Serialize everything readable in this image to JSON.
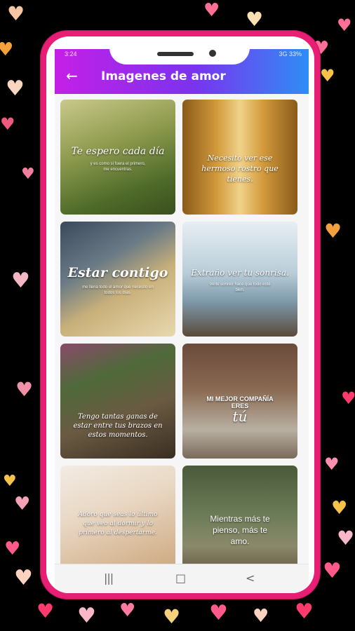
{
  "status": {
    "time": "3:24",
    "right": "3G 33%"
  },
  "appbar": {
    "title": "Imagenes de amor",
    "back_icon": "arrow-left-icon"
  },
  "cards": [
    {
      "caption": "Te espero cada día",
      "sub": "y es como si fuera el primero, me encuentras."
    },
    {
      "caption": "Necesito ver ese hermoso rostro que tienes."
    },
    {
      "caption": "Estar contigo",
      "sub": "me llena todo el amor que necesito en todos los días."
    },
    {
      "caption": "Extraño ver tu sonrisa.",
      "sub": "Verte sonreír hace que todo esté bien."
    },
    {
      "caption": "Tengo tantas ganas de estar entre tus brazos en estos momentos."
    },
    {
      "caption": "MI MEJOR COMPAÑÍA ERES",
      "emph": "tú"
    },
    {
      "caption": "Adoro que seas lo último que veo al dormir y lo primero al despertarme."
    },
    {
      "caption": "Mientras más te pienso, más te amo."
    }
  ],
  "nav": {
    "recents": "|||",
    "home": "□",
    "back": "<"
  }
}
